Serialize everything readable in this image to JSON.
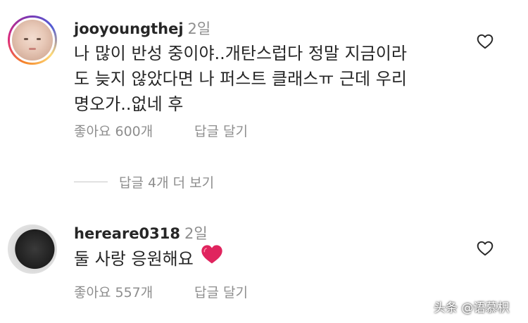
{
  "comments": [
    {
      "username": "jooyoungthej",
      "time": "2일",
      "text_lines": [
        "나 많이 반성 중이야..개탄스럽다 정말 지금이라",
        "도 늦지 않았다면 나 퍼스트 클래스ㅠ 근데 우리",
        "명오가..없네 후"
      ],
      "likes_label": "좋아요 600개",
      "reply_label": "답글 달기"
    },
    {
      "username": "hereare0318",
      "time": "2일",
      "text": "둘 사랑 응원해요",
      "emoji": "red-heart",
      "likes_label": "좋아요 557개",
      "reply_label": "답글 달기"
    }
  ],
  "view_replies_label": "답글 4개 더 보기",
  "watermark": "头条 @语慕枳",
  "colors": {
    "text": "#262626",
    "secondary": "#8e8e8e",
    "heart_red": "#e0245e"
  }
}
